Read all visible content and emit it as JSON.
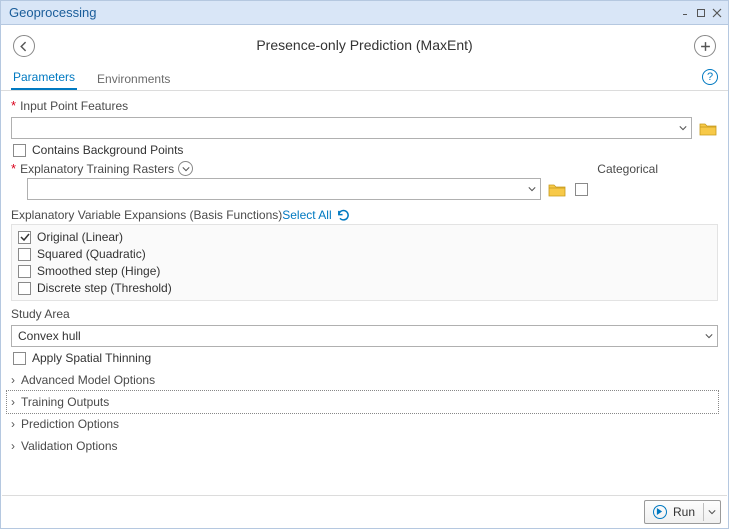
{
  "window": {
    "title": "Geoprocessing"
  },
  "tool": {
    "title": "Presence-only Prediction (MaxEnt)"
  },
  "tabs": {
    "parameters": "Parameters",
    "environments": "Environments"
  },
  "params": {
    "input_point_features": {
      "label": "Input Point Features",
      "value": ""
    },
    "contains_bg_points": {
      "label": "Contains Background Points",
      "checked": false
    },
    "explanatory_rasters": {
      "label": "Explanatory Training Rasters",
      "value": "",
      "categorical_label": "Categorical",
      "categorical_checked": false
    },
    "basis": {
      "label": "Explanatory Variable Expansions (Basis Functions)",
      "select_all": "Select All",
      "options": [
        {
          "label": "Original (Linear)",
          "checked": true
        },
        {
          "label": "Squared (Quadratic)",
          "checked": false
        },
        {
          "label": "Smoothed step (Hinge)",
          "checked": false
        },
        {
          "label": "Discrete step (Threshold)",
          "checked": false
        }
      ]
    },
    "study_area": {
      "label": "Study Area",
      "value": "Convex hull"
    },
    "apply_thinning": {
      "label": "Apply Spatial Thinning",
      "checked": false
    }
  },
  "groups": {
    "advanced": "Advanced Model Options",
    "training": "Training Outputs",
    "prediction": "Prediction Options",
    "validation": "Validation Options"
  },
  "run": {
    "label": "Run"
  }
}
